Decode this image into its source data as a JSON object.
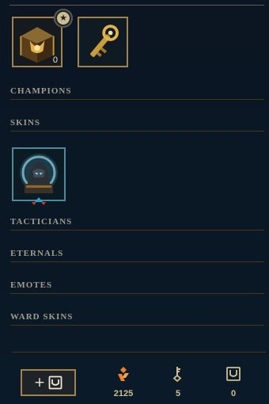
{
  "inventory": {
    "chest_count": "0"
  },
  "sections": [
    {
      "label": "CHAMPIONS"
    },
    {
      "label": "SKINS"
    },
    {
      "label": "TACTICIANS"
    },
    {
      "label": "ETERNALS"
    },
    {
      "label": "EMOTES"
    },
    {
      "label": "WARD SKINS"
    }
  ],
  "footer": {
    "add_button_label": "+",
    "currencies": [
      {
        "icon": "orange-essence-icon",
        "value": "2125"
      },
      {
        "icon": "hextech-key-icon",
        "value": "5"
      },
      {
        "icon": "hextech-chest-icon",
        "value": "0"
      }
    ]
  },
  "colors": {
    "gold_border": "#a0824a",
    "header_text": "#a09b8c",
    "divider": "#463714",
    "skin_border": "#4a8a9a",
    "essence_orange": "#e8832a"
  }
}
